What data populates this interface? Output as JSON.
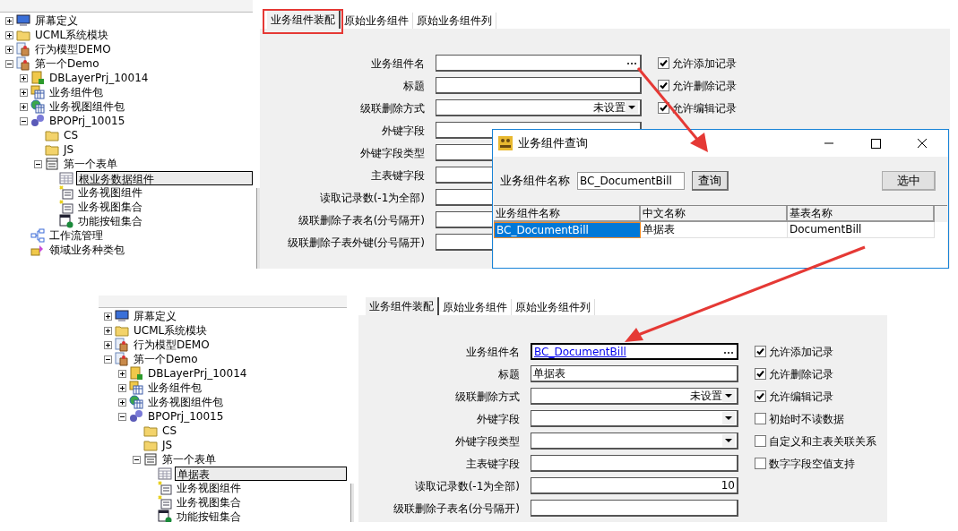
{
  "top_screen": {
    "tree": [
      {
        "label": "屏幕定义",
        "kind": "monitor",
        "expanded": false,
        "selected": false
      },
      {
        "label": "UCML系统模块",
        "kind": "folder",
        "expanded": false,
        "selected": false
      },
      {
        "label": "行为模型DEMO",
        "kind": "bag",
        "expanded": false,
        "selected": false
      },
      {
        "label": "第一个Demo",
        "kind": "bag",
        "expanded": true,
        "selected": false,
        "children": [
          {
            "label": "DBLayerPrj_10014",
            "kind": "project",
            "expanded": false,
            "selected": false
          },
          {
            "label": "业务组件包",
            "kind": "package",
            "expanded": false,
            "selected": false
          },
          {
            "label": "业务视图组件包",
            "kind": "globe",
            "expanded": false,
            "selected": false
          },
          {
            "label": "BPOPrj_10015",
            "kind": "gears",
            "expanded": true,
            "selected": false,
            "children": [
              {
                "label": "CS",
                "kind": "folder",
                "selected": false
              },
              {
                "label": "JS",
                "kind": "folder",
                "selected": false
              },
              {
                "label": "第一个表单",
                "kind": "form",
                "expanded": true,
                "selected": false,
                "children": [
                  {
                    "label": "根业务数据组件",
                    "kind": "table",
                    "selected": true
                  },
                  {
                    "label": "业务视图组件",
                    "kind": "view",
                    "selected": false
                  },
                  {
                    "label": "业务视图集合",
                    "kind": "view",
                    "selected": false
                  },
                  {
                    "label": "功能按钮集合",
                    "kind": "buttons",
                    "selected": false
                  }
                ]
              }
            ]
          },
          {
            "label": "工作流管理",
            "kind": "workflow",
            "selected": false
          },
          {
            "label": "领域业务种类包",
            "kind": "domain",
            "selected": false
          }
        ]
      }
    ],
    "tabs": [
      {
        "label": "业务组件装配",
        "selected": true
      },
      {
        "label": "原始业务组件",
        "selected": false
      },
      {
        "label": "原始业务组件列",
        "selected": false
      }
    ],
    "fields": [
      {
        "label": "业务组件名",
        "kind": "lookup"
      },
      {
        "label": "标题",
        "kind": "text"
      },
      {
        "label": "级联删除方式",
        "kind": "select",
        "value": "未设置"
      },
      {
        "label": "外键字段",
        "kind": "text"
      },
      {
        "label": "外键字段类型",
        "kind": "text"
      },
      {
        "label": "主表键字段",
        "kind": "text"
      },
      {
        "label": "读取记录数(-1为全部)",
        "kind": "number"
      },
      {
        "label": "级联删除子表名(分号隔开)",
        "kind": "text"
      },
      {
        "label": "级联删除子表外键(分号隔开)",
        "kind": "text"
      }
    ],
    "options": [
      {
        "label": "允许添加记录",
        "checked": true
      },
      {
        "label": "允许删除记录",
        "checked": true
      },
      {
        "label": "允许编辑记录",
        "checked": true
      }
    ]
  },
  "dialog": {
    "title": "业务组件查询",
    "search_label": "业务组件名称",
    "search_value": "BC_DocumentBill",
    "query_button": "查询",
    "select_button": "选中",
    "columns": [
      "业务组件名称",
      "中文名称",
      "基表名称"
    ],
    "rows": [
      {
        "cells": [
          "BC_DocumentBill",
          "单据表",
          "DocumentBill"
        ],
        "selected": true
      }
    ]
  },
  "bottom_screen": {
    "tree": [
      {
        "label": "屏幕定义",
        "kind": "monitor",
        "expanded": false,
        "selected": false
      },
      {
        "label": "UCML系统模块",
        "kind": "folder",
        "expanded": false,
        "selected": false
      },
      {
        "label": "行为模型DEMO",
        "kind": "bag",
        "expanded": false,
        "selected": false
      },
      {
        "label": "第一个Demo",
        "kind": "bag",
        "expanded": true,
        "selected": false,
        "children": [
          {
            "label": "DBLayerPrj_10014",
            "kind": "project",
            "expanded": false,
            "selected": false
          },
          {
            "label": "业务组件包",
            "kind": "package",
            "expanded": false,
            "selected": false
          },
          {
            "label": "业务视图组件包",
            "kind": "globe",
            "expanded": false,
            "selected": false
          },
          {
            "label": "BPOPrj_10015",
            "kind": "gears",
            "expanded": true,
            "selected": false,
            "children": [
              {
                "label": "CS",
                "kind": "folder",
                "selected": false
              },
              {
                "label": "JS",
                "kind": "folder",
                "selected": false
              },
              {
                "label": "第一个表单",
                "kind": "form",
                "expanded": true,
                "selected": false,
                "children": [
                  {
                    "label": "单据表",
                    "kind": "table",
                    "selected": true
                  },
                  {
                    "label": "业务视图组件",
                    "kind": "view",
                    "selected": false
                  },
                  {
                    "label": "业务视图集合",
                    "kind": "view",
                    "selected": false
                  },
                  {
                    "label": "功能按钮集合",
                    "kind": "buttons",
                    "selected": false
                  }
                ]
              }
            ]
          }
        ]
      }
    ],
    "tabs": [
      {
        "label": "业务组件装配",
        "selected": true
      },
      {
        "label": "原始业务组件",
        "selected": false
      },
      {
        "label": "原始业务组件列",
        "selected": false
      }
    ],
    "fields": [
      {
        "label": "业务组件名",
        "kind": "lookup",
        "value": "BC_DocumentBill"
      },
      {
        "label": "标题",
        "kind": "text",
        "value": "单据表"
      },
      {
        "label": "级联删除方式",
        "kind": "select",
        "value": "未设置"
      },
      {
        "label": "外键字段",
        "kind": "select"
      },
      {
        "label": "外键字段类型",
        "kind": "select"
      },
      {
        "label": "主表键字段",
        "kind": "text"
      },
      {
        "label": "读取记录数(-1为全部)",
        "kind": "number",
        "value": "10"
      },
      {
        "label": "级联删除子表名(分号隔开)",
        "kind": "text"
      }
    ],
    "options": [
      {
        "label": "允许添加记录",
        "checked": true
      },
      {
        "label": "允许删除记录",
        "checked": true
      },
      {
        "label": "允许编辑记录",
        "checked": true
      },
      {
        "label": "初始时不读数据",
        "checked": false
      },
      {
        "label": "自定义和主表关联关系",
        "checked": false
      },
      {
        "label": "数字字段空值支持",
        "checked": false
      }
    ]
  }
}
